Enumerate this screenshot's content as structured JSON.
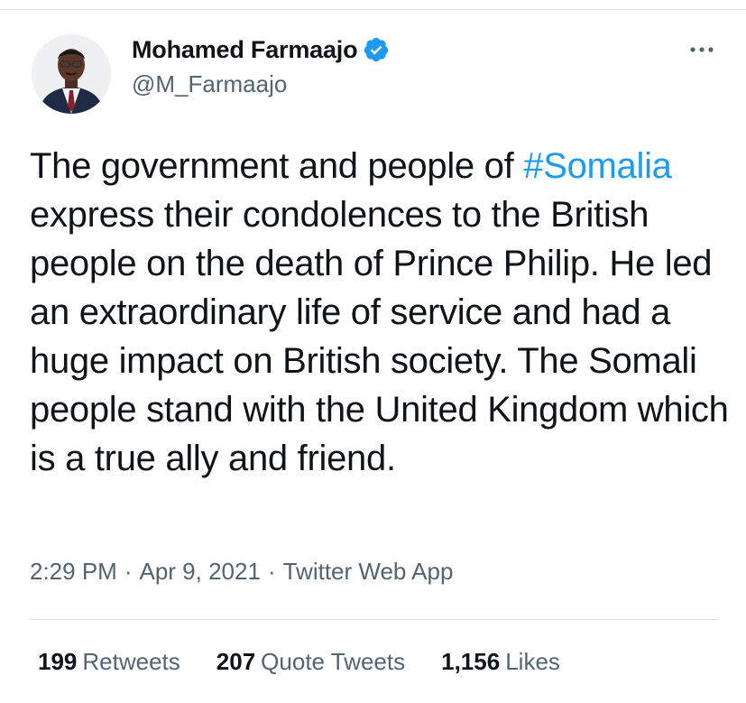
{
  "tweet": {
    "author": {
      "display_name": "Mohamed Farmaajo",
      "handle": "@M_Farmaajo",
      "verified": true,
      "verified_color": "#1d9bf0"
    },
    "text_before_hashtag": "The government and people of ",
    "hashtag": "#Somalia",
    "text_after_hashtag": " express their condolences to the British people on the death of Prince Philip. He led an extraordinary life of service and had a huge impact on British society. The Somali people stand with the United Kingdom which is a true ally and friend.",
    "time": "2:29 PM",
    "separator": "·",
    "date": "Apr 9, 2021",
    "source": "Twitter Web App",
    "stats": {
      "retweets_count": "199",
      "retweets_label": "Retweets",
      "quote_tweets_count": "207",
      "quote_tweets_label": "Quote Tweets",
      "likes_count": "1,156",
      "likes_label": "Likes"
    }
  },
  "icons": {
    "more": "more-icon",
    "verified": "verified-badge-icon",
    "avatar": "avatar"
  },
  "colors": {
    "text_primary": "#0f1419",
    "text_secondary": "#536471",
    "link": "#1d9bf0",
    "divider": "#dfe3e6"
  }
}
